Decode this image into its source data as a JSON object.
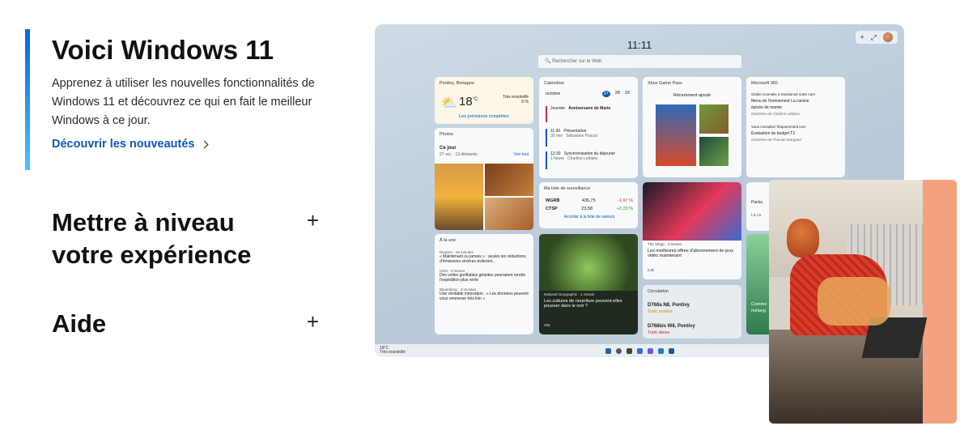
{
  "section1": {
    "title": "Voici Windows 11",
    "description": "Apprenez à utiliser les nouvelles fonctionnalités de Windows 11 et découvrez ce qui en fait le meilleur Windows à ce jour.",
    "link_label": "Découvrir les nouveautés"
  },
  "accordion": [
    {
      "title": "Mettre à niveau votre expérience",
      "icon": "plus-icon",
      "symbol": "+"
    },
    {
      "title": "Aide",
      "icon": "plus-icon",
      "symbol": "+"
    }
  ],
  "desktop": {
    "time": "11:11",
    "search_placeholder": "Rechercher sur le Web",
    "weather": {
      "location": "Pontivy, Bretagne",
      "temp": "18",
      "unit": "°C",
      "condition": "Très ensoleillé",
      "rain": "0 %",
      "link": "Les prévisions complètes"
    },
    "calendar": {
      "title": "Calendrier",
      "month": "octobre",
      "days": [
        "27",
        "28",
        "29"
      ],
      "events": [
        {
          "time": "Journée",
          "title": "Anniversaire de Marie",
          "sub": ""
        },
        {
          "time": "11:30",
          "dur": "30 min",
          "title": "Présentation",
          "sub": "Sébastien Pascal"
        },
        {
          "time": "12:30",
          "dur": "1 heure",
          "title": "Synchronisation du déjeuner",
          "sub": "Charline Leblanc"
        }
      ]
    },
    "gamepass": {
      "title": "Xbox Game Pass",
      "subtitle": "Récemment ajouté"
    },
    "m365": {
      "title": "Microsoft 365",
      "items": [
        "Gisèle Connelie a mentionné votre nom",
        "Menu de l'événement La cuisine épicée de mamie",
        "OneDrive de Charline Leblanc",
        "Vous consultez fréquemment ceci",
        "Évaluation du budget T2",
        "OneDrive de Thomas Morgand",
        "Packa",
        "La ca"
      ]
    },
    "photos": {
      "title": "Photos",
      "heading": "Ce jour",
      "sub": "27 oct. · 13 éléments",
      "link": "Voir tout"
    },
    "watchlist": {
      "title": "Ma liste de surveillance",
      "rows": [
        {
          "sym": "WGRB",
          "val": "435,75",
          "chg": "-1,67 %"
        },
        {
          "sym": "CTSP",
          "val": "23,58",
          "chg": "+2,23 %"
        }
      ],
      "link": "Accéder à la liste de valeurs"
    },
    "news": {
      "title": "À la une",
      "items": [
        {
          "src": "Reuters · 18 minutes",
          "text": "« Maintenant ou jamais » : seules les réductions d'émissions sévères éviteront..."
        },
        {
          "src": "CNN · 2 heures",
          "text": "Des voiles gonflables géantes pourraient rendre l'expédition plus verte"
        },
        {
          "src": "Bloomberg · 3 minutes",
          "text": "Une véritable innovation : « Les données peuvent vous emmener très loin »"
        }
      ]
    },
    "natgeo": {
      "src": "National Geographic · 1 minute",
      "text": "Les cultures de nourriture peuvent-elles pousser dans le noir ?",
      "count": "496"
    },
    "verge": {
      "src": "The Verge · 4 heures",
      "text": "Les meilleures offres d'abonnement de jeux vidéo maintenant",
      "count": "5,6k"
    },
    "traffic": {
      "title": "Circulation",
      "r1": "D768a N8, Pontivy",
      "r1s": "Trafic modéré",
      "r2": "D768bis W8, Pontivy",
      "r2s": "Trafic dense"
    },
    "misc": {
      "t1": "Comme",
      "t2": "mélang"
    },
    "taskbar": {
      "temp": "18°C",
      "cond": "Très ensoleillé"
    },
    "colors": {
      "up": "#1a9c3c",
      "down": "#c42b1c",
      "accent": "#0a5bb3",
      "orange": "#f4a17f"
    }
  }
}
